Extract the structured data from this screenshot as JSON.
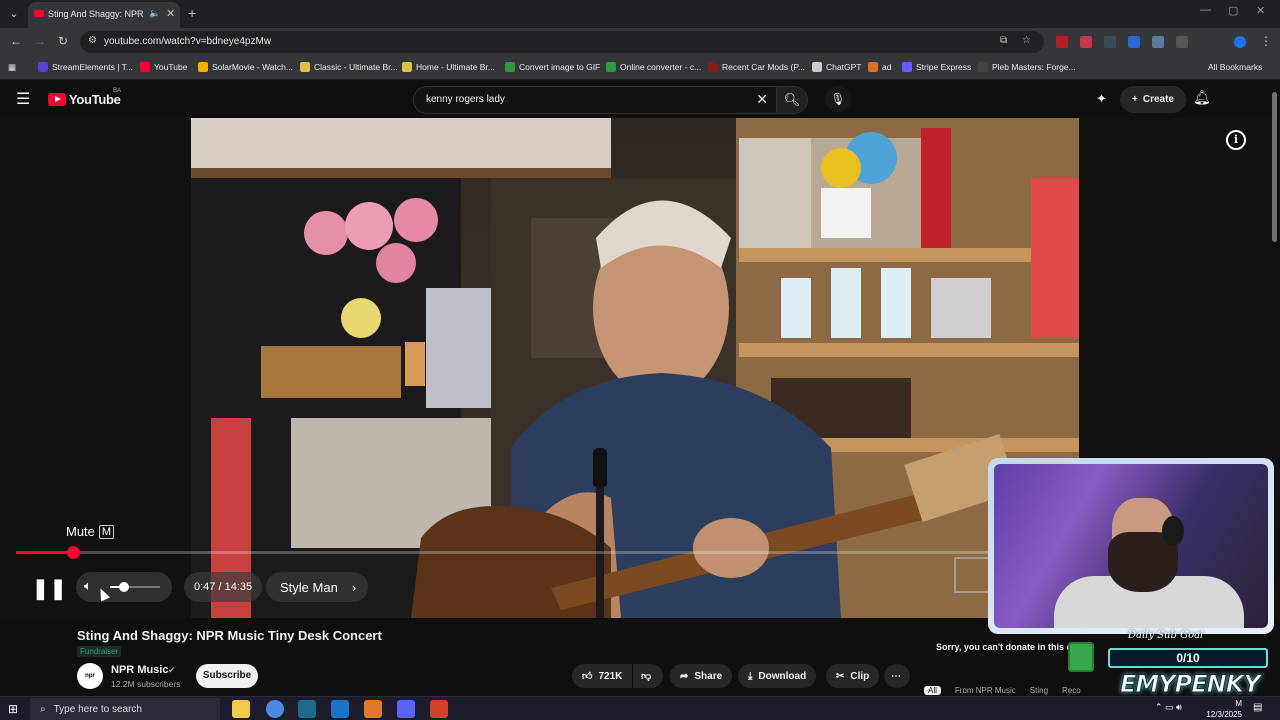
{
  "browser": {
    "tab": {
      "title": "Sting And Shaggy: NPR Music Tiny Desk Concert",
      "audio_icon": "speaker-icon",
      "close": "✕"
    },
    "new_tab": "+",
    "url": "youtube.com/watch?v=bdneye4pzMw",
    "bookmarks": [
      {
        "label": "StreamElements | T...",
        "color": "#5a3fd8"
      },
      {
        "label": "YouTube",
        "color": "#ff0033"
      },
      {
        "label": "SolarMovie - Watch...",
        "color": "#f0b400"
      },
      {
        "label": "Classic - Ultimate Br...",
        "color": "#e0c040"
      },
      {
        "label": "Home - Ultimate Br...",
        "color": "#e0c040"
      },
      {
        "label": "Convert image to GIF",
        "color": "#2e9a3e"
      },
      {
        "label": "Online converter - c...",
        "color": "#2e9a3e"
      },
      {
        "label": "Recent Car Mods (P...",
        "color": "#8a1a1a"
      },
      {
        "label": "ChatGPT",
        "color": "#cccccc"
      },
      {
        "label": "ad",
        "color": "#e07020"
      },
      {
        "label": "Stripe Express",
        "color": "#635bff"
      },
      {
        "label": "Pleb Masters: Forge...",
        "color": "#444444"
      }
    ],
    "all_bookmarks": "All Bookmarks"
  },
  "youtube": {
    "logo_text": "YouTube",
    "country_code": "BA",
    "search": {
      "query": "kenny rogers lady"
    },
    "create_label": "Create"
  },
  "player": {
    "tooltip": {
      "label": "Mute",
      "key": "M"
    },
    "current_time": "0:47",
    "duration": "14:35",
    "time_display": "0:47 / 14:35",
    "chapter": "Style Man",
    "progress_fraction": 0.054,
    "volume_fraction": 0.28
  },
  "video": {
    "title": "Sting And Shaggy: NPR Music Tiny Desk Concert",
    "badge": "Fundraiser",
    "channel": {
      "name": "NPR Music",
      "avatar_text": "npr music",
      "subscribers": "12.2M subscribers"
    },
    "subscribe_label": "Subscribe",
    "likes": "721K",
    "share_label": "Share",
    "download_label": "Download",
    "clip_label": "Clip",
    "donate_message": "Sorry, you can't donate in this co",
    "chips": [
      "All",
      "From NPR Music",
      "Sting",
      "Reco"
    ]
  },
  "stream_overlay": {
    "goal_title": "Daily Sub Goal",
    "goal_progress": "0/10",
    "streamer_name": "EMYPENKY"
  },
  "taskbar": {
    "search_placeholder": "Type here to search",
    "time": "M",
    "date": "12/3/2025"
  }
}
